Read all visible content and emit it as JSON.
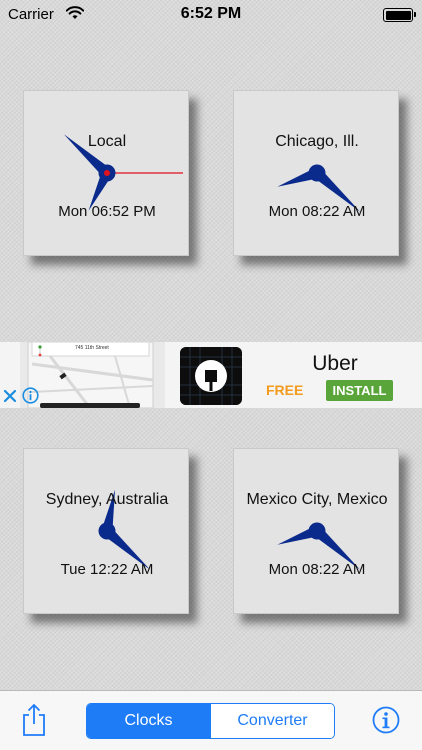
{
  "status_bar": {
    "carrier": "Carrier",
    "time": "6:52 PM",
    "wifi_icon": "wifi-icon",
    "battery_icon": "battery-full-icon"
  },
  "clocks": [
    {
      "city": "Local",
      "datetime": "Mon 06:52 PM",
      "hour": 6,
      "minute": 52,
      "show_second_hand": true,
      "second": 15
    },
    {
      "city": "Chicago, Ill.",
      "datetime": "Mon 08:22 AM",
      "hour": 8,
      "minute": 22,
      "show_second_hand": false
    },
    {
      "city": "Sydney, Australia",
      "datetime": "Tue 12:22 AM",
      "hour": 12,
      "minute": 22,
      "show_second_hand": false
    },
    {
      "city": "Mexico City, Mexico",
      "datetime": "Mon 08:22 AM",
      "hour": 8,
      "minute": 22,
      "show_second_hand": false
    }
  ],
  "ad": {
    "brand": "Uber",
    "free_label": "FREE",
    "install_label": "INSTALL",
    "map_street": "745 11th Street",
    "close_icon": "close-icon",
    "adchoices_icon": "info-icon"
  },
  "toolbar": {
    "share_icon": "share-icon",
    "tabs": [
      "Clocks",
      "Converter"
    ],
    "active_tab": "Clocks",
    "info_icon": "info-icon"
  },
  "colors": {
    "accent": "#1f7cf7",
    "hand": "#0a2a8c",
    "second_hand": "#e0121d",
    "free": "#f29b1d",
    "install": "#5aa53a"
  }
}
